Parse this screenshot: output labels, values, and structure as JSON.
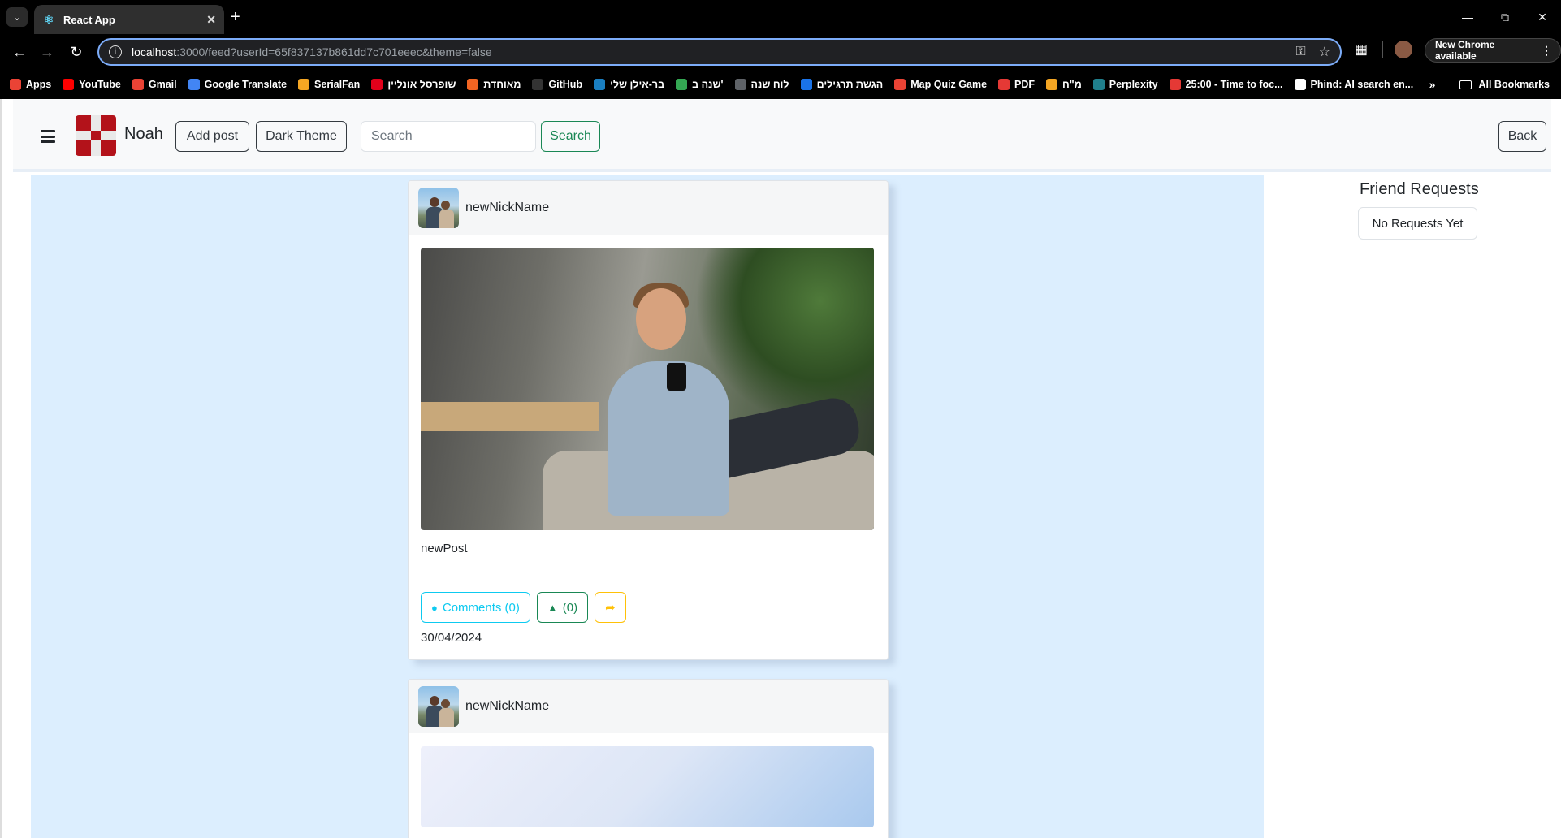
{
  "browser": {
    "tab_title": "React App",
    "url_host": "localhost",
    "url_rest": ":3000/feed?userId=65f837137b861dd7c701eeec&theme=false",
    "new_chrome_label": "New Chrome available",
    "bookmarks": [
      {
        "label": "Apps",
        "icon": "apps-grid-icon",
        "color": "#ea4335"
      },
      {
        "label": "YouTube",
        "icon": "youtube-icon",
        "color": "#ff0000"
      },
      {
        "label": "Gmail",
        "icon": "gmail-icon",
        "color": "#ea4335"
      },
      {
        "label": "Google Translate",
        "icon": "translate-icon",
        "color": "#4285f4"
      },
      {
        "label": "SerialFan",
        "icon": "serialfan-icon",
        "color": "#f5a623"
      },
      {
        "label": "שופרסל אונליין",
        "icon": "shufersal-icon",
        "color": "#e2001a"
      },
      {
        "label": "מאוחדת",
        "icon": "meuhedet-icon",
        "color": "#f26522"
      },
      {
        "label": "GitHub",
        "icon": "github-icon",
        "color": "#333333"
      },
      {
        "label": "בר-אילן שלי",
        "icon": "biu-icon",
        "color": "#1a7fc1"
      },
      {
        "label": "שנה ב'",
        "icon": "drive-icon",
        "color": "#34a853"
      },
      {
        "label": "לוח שנה",
        "icon": "calendar-icon",
        "color": "#5f6368"
      },
      {
        "label": "הגשת תרגילים",
        "icon": "upload-icon",
        "color": "#1a73e8"
      },
      {
        "label": "Map Quiz Game",
        "icon": "map-pin-icon",
        "color": "#ea4335"
      },
      {
        "label": "PDF",
        "icon": "pdf-icon",
        "color": "#e53935"
      },
      {
        "label": "מ\"ח",
        "icon": "mh-icon",
        "color": "#f5a623"
      },
      {
        "label": "Perplexity",
        "icon": "perplexity-icon",
        "color": "#20808d"
      },
      {
        "label": "25:00 - Time to foc...",
        "icon": "timer-icon",
        "color": "#e53935"
      },
      {
        "label": "Phind: AI search en...",
        "icon": "phind-icon",
        "color": "#ffffff"
      }
    ],
    "all_bookmarks_label": "All Bookmarks"
  },
  "navbar": {
    "username": "Noah",
    "add_post_label": "Add post",
    "dark_theme_label": "Dark Theme",
    "search_placeholder": "Search",
    "search_button_label": "Search",
    "back_label": "Back"
  },
  "posts": [
    {
      "nickname": "newNickName",
      "text": "newPost",
      "comments_label": "Comments (0)",
      "likes_label": "(0)",
      "date": "30/04/2024"
    },
    {
      "nickname": "newNickName"
    }
  ],
  "sidebar": {
    "title": "Friend Requests",
    "empty_label": "No Requests Yet"
  },
  "colors": {
    "feed_background": "#dceefe",
    "info": "#0dcaf0",
    "success": "#198754",
    "warning": "#ffc107",
    "dark": "#343a40"
  }
}
